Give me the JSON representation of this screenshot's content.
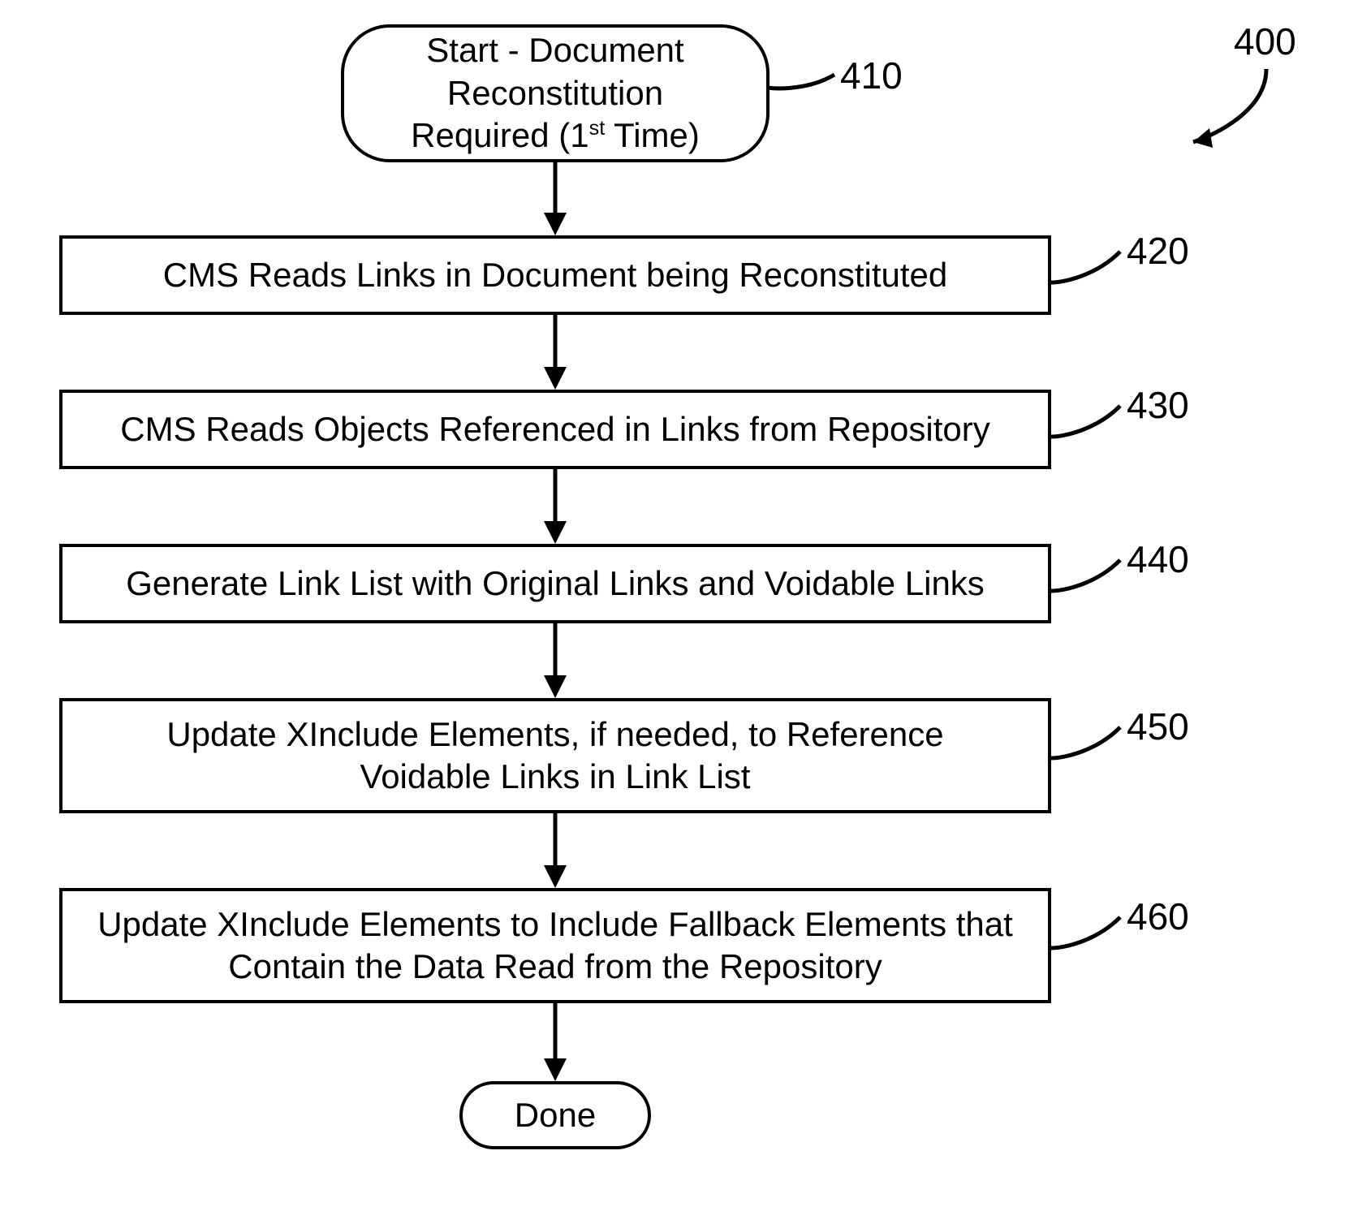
{
  "diagram": {
    "figure_ref": "400",
    "start": {
      "text_line1": "Start - Document",
      "text_line2": "Reconstitution",
      "text_line3_prefix": "Required (1",
      "text_line3_sup": "st",
      "text_line3_suffix": " Time)",
      "ref": "410"
    },
    "steps": [
      {
        "text": "CMS Reads Links in Document being Reconstituted",
        "ref": "420"
      },
      {
        "text": "CMS Reads Objects Referenced in Links from Repository",
        "ref": "430"
      },
      {
        "text": "Generate Link List with Original Links and Voidable Links",
        "ref": "440"
      },
      {
        "text": "Update XInclude Elements, if needed, to Reference Voidable Links in Link List",
        "ref": "450"
      },
      {
        "text": "Update XInclude Elements to Include Fallback Elements that Contain the Data Read from the Repository",
        "ref": "460"
      }
    ],
    "end": {
      "text": "Done"
    }
  }
}
